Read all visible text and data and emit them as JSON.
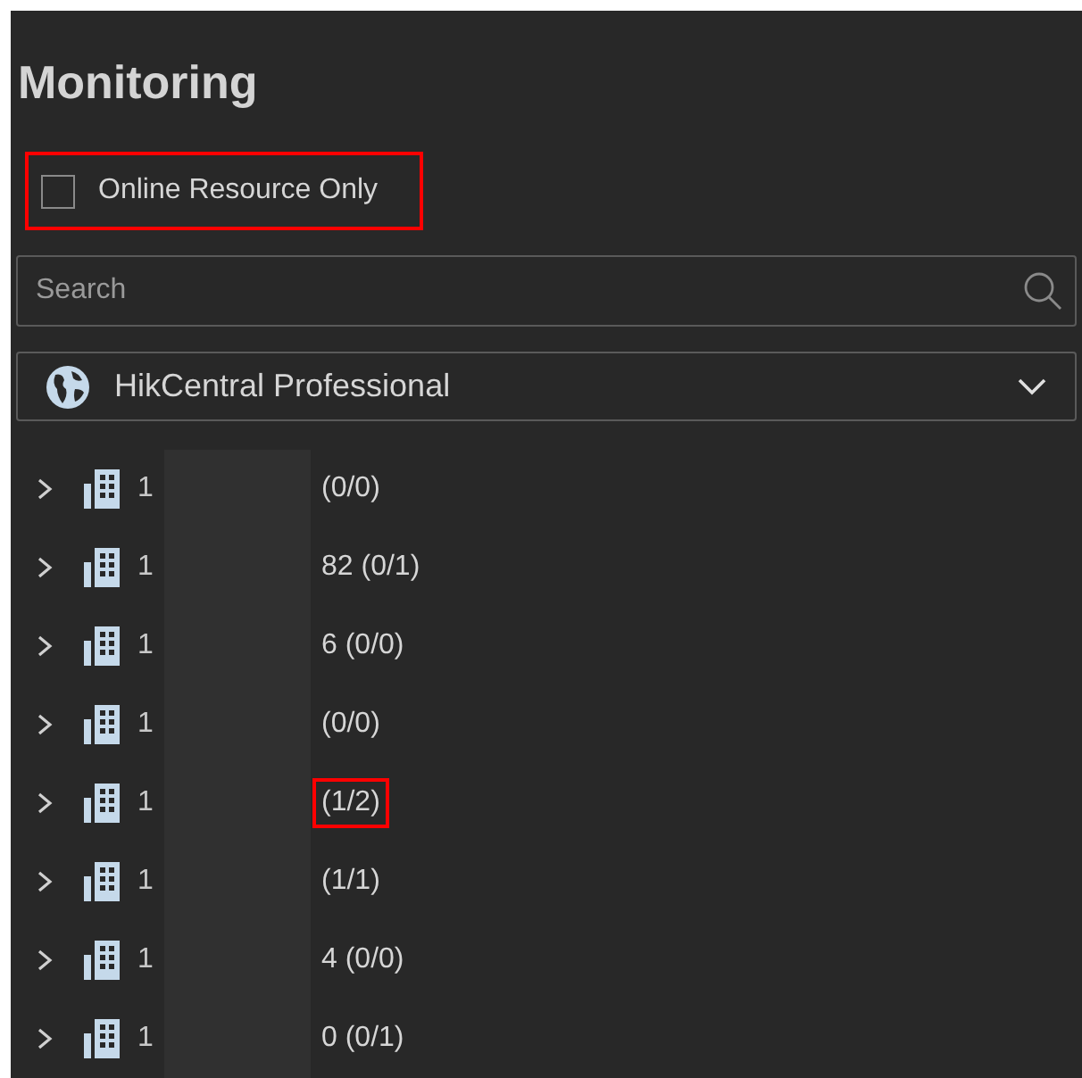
{
  "title": "Monitoring",
  "online_only": {
    "label": "Online Resource Only",
    "checked": false,
    "highlighted": true
  },
  "search": {
    "placeholder": "Search"
  },
  "site_select": {
    "value": "HikCentral Professional"
  },
  "areas": [
    {
      "prefix": "1",
      "suffix": "(0/0)",
      "expanded": false,
      "highlighted": false
    },
    {
      "prefix": "1",
      "suffix": "82 (0/1)",
      "expanded": false,
      "highlighted": false
    },
    {
      "prefix": "1",
      "suffix": "6 (0/0)",
      "expanded": false,
      "highlighted": false
    },
    {
      "prefix": "1",
      "suffix": "(0/0)",
      "expanded": false,
      "highlighted": false
    },
    {
      "prefix": "1",
      "suffix": "(1/2)",
      "expanded": false,
      "highlighted": true
    },
    {
      "prefix": "1",
      "suffix": "(1/1)",
      "expanded": false,
      "highlighted": false
    },
    {
      "prefix": "1",
      "suffix": "4 (0/0)",
      "expanded": false,
      "highlighted": false
    },
    {
      "prefix": "1",
      "suffix": "0 (0/1)",
      "expanded": false,
      "highlighted": false
    }
  ]
}
